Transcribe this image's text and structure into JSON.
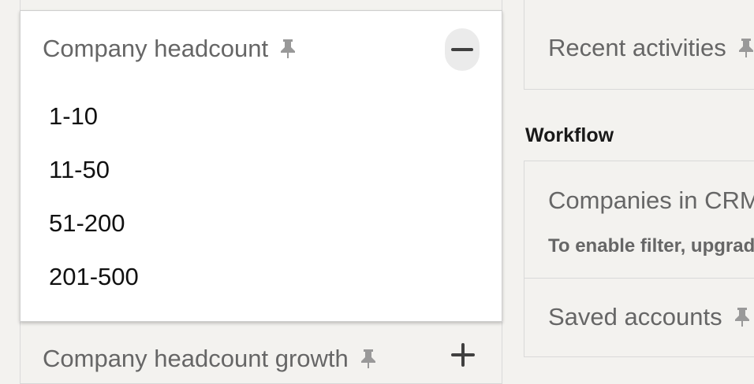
{
  "filters": {
    "company_headcount": {
      "label": "Company headcount",
      "options": [
        "1-10",
        "11-50",
        "51-200",
        "201-500"
      ]
    },
    "company_headcount_growth": {
      "label": "Company headcount growth"
    }
  },
  "right": {
    "recent_activities_label": "Recent activities",
    "workflow_title": "Workflow",
    "companies_in_crm_label": "Companies in CRM",
    "upgrade_note": "To enable filter, upgrade",
    "saved_accounts_label": "Saved accounts"
  },
  "icons": {
    "pin": "pin-icon",
    "collapse": "minus-icon",
    "expand": "plus-icon"
  },
  "colors": {
    "background": "#f3f2ef",
    "muted_text": "#666666",
    "pin": "#999999"
  }
}
